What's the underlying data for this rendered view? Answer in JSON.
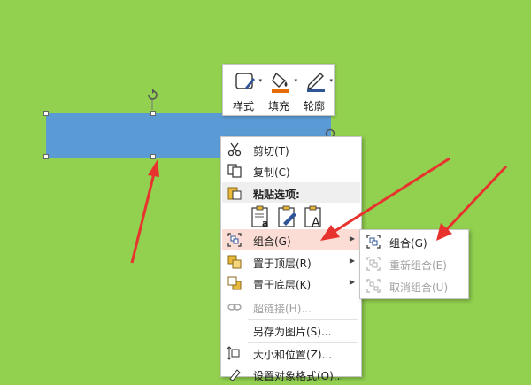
{
  "mini_toolbar": {
    "style_label": "样式",
    "fill_label": "填充",
    "outline_label": "轮廓",
    "fill_color": "#e36c09"
  },
  "context_menu": {
    "cut": "剪切(T)",
    "copy": "复制(C)",
    "paste_options": "粘贴选项:",
    "group": "组合(G)",
    "bring_to_front": "置于顶层(R)",
    "send_to_back": "置于底层(K)",
    "hyperlink": "超链接(H)...",
    "save_as_picture": "另存为图片(S)...",
    "size_position": "大小和位置(Z)...",
    "format_object": "设置对象格式(O)..."
  },
  "submenu": {
    "group": "组合(G)",
    "regroup": "重新组合(E)",
    "ungroup": "取消组合(U)"
  },
  "colors": {
    "background": "#92d050",
    "shape": "#5b9bd5",
    "arrow": "#e8322d",
    "highlight": "#fcddd5"
  }
}
